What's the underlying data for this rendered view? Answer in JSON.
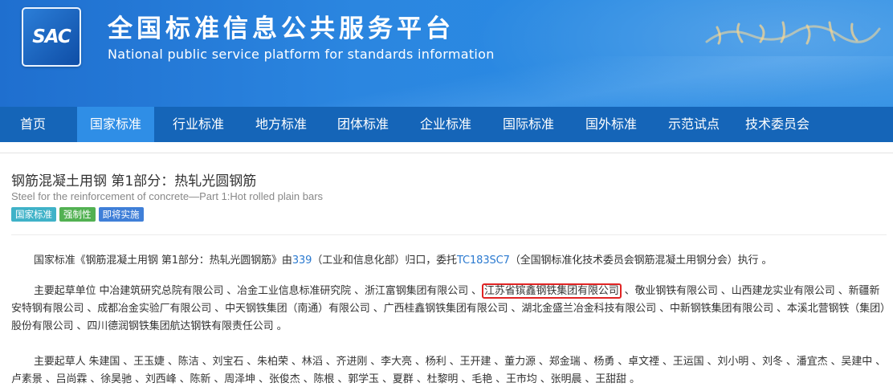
{
  "header": {
    "logo_text": "SAC",
    "title_cn": "全国标准信息公共服务平台",
    "title_en": "National public service platform  for standards information"
  },
  "nav": {
    "items": [
      "首页",
      "国家标准",
      "行业标准",
      "地方标准",
      "团体标准",
      "企业标准",
      "国际标准",
      "国外标准",
      "示范试点",
      "技术委员会"
    ],
    "active_index": 1
  },
  "standard": {
    "title": "钢筋混凝土用钢 第1部分：热轧光圆钢筋",
    "title_en": "Steel for the reinforcement of concrete—Part 1:Hot rolled plain bars",
    "badges": [
      {
        "label": "国家标准",
        "color": "#3fb2c8"
      },
      {
        "label": "强制性",
        "color": "#52b152"
      },
      {
        "label": "即将实施",
        "color": "#3f7fd8"
      }
    ]
  },
  "intro": {
    "prefix": "国家标准《钢筋混凝土用钢 第1部分：热轧光圆钢筋》由",
    "dept_code": "339",
    "dept_name": "（工业和信息化部）归口，委托",
    "tc_code": "TC183SC7",
    "tc_name": "（全国钢标准化技术委员会钢筋混凝土用钢分会）执行 。"
  },
  "drafting_units": {
    "label": "主要起草单位 ",
    "before_highlight": "中冶建筑研究总院有限公司 、冶金工业信息标准研究院 、浙江富钢集团有限公司 、",
    "highlight": "江苏省镔鑫钢铁集团有限公司",
    "after_highlight": " 、敬业钢铁有限公司 、山西建龙实业有限公司 、新疆新安特钢有限公司 、成都冶金实验厂有限公司 、中天钢铁集团（南通）有限公司 、广西桂鑫钢铁集团有限公司 、湖北金盛兰冶金科技有限公司 、中新钢铁集团有限公司 、本溪北营钢铁（集团）股份有限公司 、四川德润钢铁集团航达钢铁有限责任公司 。"
  },
  "drafters": {
    "label": "主要起草人 ",
    "names": "朱建国 、王玉婕 、陈洁 、刘宝石 、朱柏荣 、林滔 、齐进刚 、李大亮 、杨利 、王开建 、董力源 、郑金瑞 、杨勇 、卓文禋 、王运国 、刘小明 、刘冬 、潘宜杰 、吴建中 、卢素景 、吕尚霖 、徐昊驰 、刘西峰 、陈新 、周泽坤 、张俊杰 、陈根 、郭学玉 、夏群 、杜黎明 、毛艳 、王市均 、张明晨 、王甜甜 。"
  }
}
